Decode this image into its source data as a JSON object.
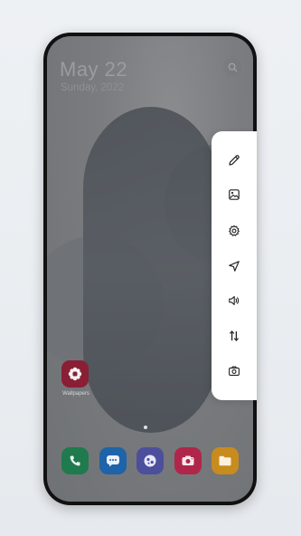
{
  "lockscreen": {
    "time": "May 22",
    "date": "Sunday, 2022"
  },
  "home": {
    "app_label": "Wallpapers"
  },
  "dock": {
    "apps": [
      "phone-app",
      "messages-app",
      "community-app",
      "camera-app",
      "files-app"
    ]
  },
  "edge_panel": {
    "tools": [
      "edit-icon",
      "wallpaper-icon",
      "settings-icon",
      "navigation-icon",
      "sound-icon",
      "data-transfer-icon",
      "screenshot-icon"
    ]
  },
  "colors": {
    "panel": "#ffffff",
    "phone_frame": "#111111",
    "gallery_app": "#8a1e35"
  }
}
